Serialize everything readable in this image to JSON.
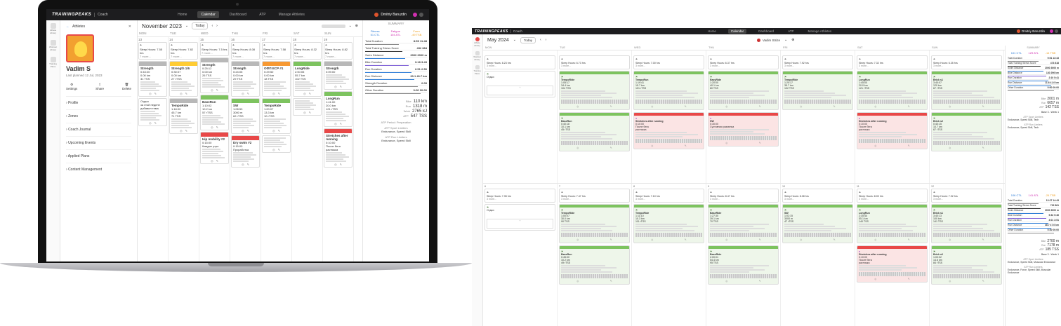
{
  "app": {
    "brand": "TRAININGPEAKS",
    "sub": "Coach",
    "nav": [
      "Home",
      "Calendar",
      "Dashboard",
      "ATP",
      "Manage Athletes"
    ],
    "active_nav": "Calendar",
    "user": "Dmitriy Baruzdin",
    "badge": "5"
  },
  "colors": {
    "nav_bg": "#1d1d1f",
    "green": "#7dc35f",
    "yellow": "#ffcc33",
    "orange": "#f79932",
    "red": "#e84848",
    "gray": "#b8b8b8",
    "accent_blue": "#2b7bd6",
    "fitness_blue": "#2b7bd6",
    "fatigue_pink": "#d12fb1",
    "form_orange": "#f0a020"
  },
  "left": {
    "sidebar": [
      {
        "label": "Athlete Library",
        "icon": "people-icon"
      },
      {
        "label": "Workout Library",
        "icon": "library-icon"
      },
      {
        "label": "Training Plans",
        "icon": "plans-icon"
      }
    ],
    "athlete_panel": {
      "header": "Athletes",
      "name": "Vadim S",
      "last_planned": "Last planned 12 Jul, 2023",
      "actions": [
        "Settings",
        "Share",
        "Delete"
      ],
      "menu": [
        "Profile",
        "Zones",
        "Coach Journal",
        "Upcoming Events",
        "Applied Plans",
        "Content Management"
      ]
    },
    "calendar": {
      "month": "November 2023",
      "today": "Today",
      "days": [
        "MON",
        "TUE",
        "WED",
        "THU",
        "FRI",
        "SAT",
        "SUN"
      ],
      "dates": [
        "13",
        "14",
        "15",
        "16",
        "17",
        "18",
        "19"
      ],
      "sleep": [
        "Sleep Hours: 7.55 hrs",
        "Sleep Hours: 7.82 hrs",
        "Sleep Hours: 7.5 hrs",
        "Sleep Hours: 8.08 hrs",
        "Sleep Hours: 7.58 hrs",
        "Sleep Hours: 8.32 hrs",
        "Sleep Hours: 8.82 hrs"
      ],
      "more": "7 more...",
      "cards": [
        [
          {
            "title": "Strength",
            "l1": "0:43:20",
            "l2": "0.00 km",
            "l3": "31 TSS",
            "color": "gy"
          },
          {
            "title": "",
            "l1": "Отдых",
            "l2": "за этой неделе",
            "l3": "добавил тема",
            "color": "none"
          }
        ],
        [
          {
            "title": "Strength 1/6",
            "l1": "0:30:07",
            "l2": "0.00 km",
            "l3": "27 rTSS",
            "color": "y"
          },
          {
            "title": "TempoRide",
            "l1": "1:18:00",
            "l2": "45.7 km",
            "l3": "71 TSS",
            "color": "gy"
          }
        ],
        [
          {
            "title": "Strength",
            "l1": "0:25:12",
            "l2": "0.00 km",
            "l3": "26 TSS",
            "color": "gy"
          },
          {
            "title": "BaseRun",
            "l1": "1:10:02",
            "l2": "10.2 km",
            "l3": "57 rTSS",
            "color": "g"
          },
          {
            "title": "Hip mobility #2",
            "l1": "0:15:00",
            "l2": "Каждое утро",
            "l3": "",
            "color": "r"
          }
        ],
        [
          {
            "title": "Strength",
            "l1": "0:24:05",
            "l2": "0.00 km",
            "l3": "29 TSS",
            "color": "gy"
          },
          {
            "title": "SW",
            "l1": "1:08:53",
            "l2": "3000 m",
            "l3": "62 rTSS",
            "color": "g"
          },
          {
            "title": "Dry swim #2",
            "l1": "0:15:00",
            "l2": "Проработка",
            "l3": "",
            "color": "r"
          }
        ],
        [
          {
            "title": "ОФП ЕСР #1",
            "l1": "0:29:50",
            "l2": "0.00 km",
            "l3": "18 TSS",
            "color": "o"
          },
          {
            "title": "TempoRide",
            "l1": "1:00:07",
            "l2": "13.3 km",
            "l3": "10 rTSS",
            "color": "g"
          },
          {
            "title": "",
            "l1": "",
            "l2": "",
            "l3": "",
            "color": "none"
          }
        ],
        [
          {
            "title": "LongRide",
            "l1": "2:00:05",
            "l2": "55.7 km",
            "l3": "102 TSS",
            "color": "g"
          },
          {
            "title": "",
            "l1": "",
            "l2": "",
            "l3": "",
            "color": "none"
          }
        ],
        [
          {
            "title": "Strength",
            "l1": "0:09:00",
            "l2": "",
            "l3": "",
            "color": "gy"
          },
          {
            "title": "LongRun",
            "l1": "1:41:00",
            "l2": "20.0 km",
            "l3": "121 rTSS",
            "color": "g"
          },
          {
            "title": "Stretches after running",
            "l1": "0:10:00",
            "l2": "После бега",
            "l3": "растяжка",
            "color": "r"
          }
        ]
      ]
    },
    "summary": {
      "title": "SUMMARY",
      "fitness_lbl": "Fitness",
      "fitness": "51 CTL",
      "fatigue_lbl": "Fatigue",
      "fatigue": "104 ATL",
      "form_lbl": "Form",
      "form": "-49 TSB",
      "rows": [
        [
          "Total Duration",
          "8:59 11:48"
        ],
        [
          "Total Training Stress Score",
          "432 684"
        ],
        [
          "Swim Distance",
          "3000 3000 m"
        ],
        [
          "Bike Duration",
          "3:18 3:43"
        ],
        [
          "Run Duration",
          "2:51 2:50"
        ],
        [
          "Run Distance",
          "30.1 40.7 km"
        ],
        [
          "Strength Duration",
          "2:09"
        ],
        [
          "Other Duration",
          "0:00 00:00"
        ]
      ],
      "extra": [
        [
          "Bike",
          "110 km"
        ],
        [
          "Run",
          "1318 m"
        ],
        [
          "Work",
          "2765 kJ"
        ],
        [
          "ATP",
          "547 TSS"
        ]
      ],
      "atp_period": "Preparation",
      "limiters": "Endurance, Speed Skill",
      "strengths": "Endurance, Speed Skill"
    }
  },
  "right": {
    "calendar": {
      "month": "May 2024",
      "today": "Today",
      "athlete": "Vadim Strize",
      "days": [
        "MON",
        "TUE",
        "WED",
        "THU",
        "FRI",
        "SAT",
        "SUN"
      ],
      "week1": {
        "dates": [
          "",
          "",
          "",
          "",
          "",
          "",
          ""
        ],
        "sleep": [
          "Sleep Hours: 8.23 hrs",
          "Sleep Hours: 6.73 hrs",
          "Sleep Hours: 7.00 hrs",
          "Sleep Hours: 6.37 hrs",
          "Sleep Hours: 7.92 hrs",
          "Sleep Hours: 7.32 hrs",
          "Sleep Hours: 6.35 hrs"
        ],
        "more": [
          "3 more...",
          "3 more...",
          "3 more...",
          "3 more...",
          "3 more...",
          "3 more...",
          "3 more..."
        ],
        "cards": [
          [
            {
              "title": "Отдых",
              "l1": "",
              "l2": "",
              "l3": "",
              "color": "none",
              "bg": "#fff"
            }
          ],
          [
            {
              "title": "TempoRide",
              "l1": "1:05:17",
              "l2": "34.4 km",
              "l3": "104 TSS",
              "color": "g",
              "bg": "#eef6ea"
            },
            {
              "title": "BaseRun",
              "l1": "0:40:18",
              "l2": "10.1 km",
              "l3": "45 rTSS",
              "color": "g",
              "bg": "#eef6ea"
            }
          ],
          [
            {
              "title": "TempoRun",
              "l1": "1:19:41",
              "l2": "15.7 km",
              "l3": "101 rTSS",
              "color": "g",
              "bg": "#eef6ea"
            },
            {
              "title": "Stretches after running",
              "l1": "0:10:00",
              "l2": "После бега",
              "l3": "растяжка",
              "color": "r",
              "bg": "#fbe4e4"
            }
          ],
          [
            {
              "title": "EasyRide",
              "l1": "1:20:00",
              "l2": "40.1 km",
              "l3": "80 TSS",
              "color": "g",
              "bg": "#eef6ea"
            },
            {
              "title": "SW",
              "l1": "0:30:00",
              "l2": "Суставная разминка",
              "l3": "",
              "color": "r",
              "bg": "#fbe4e4"
            }
          ],
          [
            {
              "title": "TempoRide",
              "l1": "1:20:17",
              "l2": "35.7 km",
              "l3": "102 TSS",
              "color": "g",
              "bg": "#eef6ea"
            }
          ],
          [
            {
              "title": "LongRun",
              "l1": "1:45:00",
              "l2": "20.0 km",
              "l3": "121 rTSS",
              "color": "g",
              "bg": "#eef6ea"
            },
            {
              "title": "Stretches after running",
              "l1": "0:10:00",
              "l2": "После бега",
              "l3": "растяжка",
              "color": "r",
              "bg": "#fbe4e4"
            }
          ],
          [
            {
              "title": "Brick s1",
              "l1": "3:40:07",
              "l2": "120 km",
              "l3": "67 rTSS",
              "color": "g",
              "bg": "#eef6ea"
            },
            {
              "title": "Brick s2",
              "l1": "0:40:15",
              "l2": "10.7 km",
              "l3": "67 rTSS",
              "color": "g",
              "bg": "#eef6ea"
            }
          ]
        ]
      },
      "week2": {
        "dates": [
          "6",
          "7",
          "8",
          "9",
          "10",
          "11",
          "12"
        ],
        "sleep": [
          "Sleep Hours: 7.35 hrs",
          "Sleep Hours: 7.47 hrs",
          "Sleep Hours: 7.10 hrs",
          "Sleep Hours: 8.47 hrs",
          "Sleep Hours: 8.08 hrs",
          "Sleep Hours: 8.00 hrs",
          "Sleep Hours: 7.92 hrs"
        ],
        "more": [
          "3 more...",
          "3 more...",
          "3 more...",
          "3 more...",
          "3 more...",
          "3 more...",
          "3 more..."
        ],
        "cards": [
          [
            {
              "title": "Отдых",
              "l1": "",
              "l2": "",
              "l3": "",
              "color": "none",
              "bg": "#fff"
            }
          ],
          [
            {
              "title": "TempoRide",
              "l1": "1:00:07",
              "l2": "30.0 km",
              "l3": "90 TSS",
              "color": "g",
              "bg": "#eef6ea"
            },
            {
              "title": "BaseRun",
              "l1": "0:45:00",
              "l2": "10.2 km",
              "l3": "49 rTSS",
              "color": "g",
              "bg": "#eef6ea"
            }
          ],
          [
            {
              "title": "TempoRide",
              "l1": "1:11:10",
              "l2": "10.3 km",
              "l3": "111 rTSS",
              "color": "g",
              "bg": "#eef6ea"
            }
          ],
          [
            {
              "title": "BaseRide",
              "l1": "1:27:30",
              "l2": "39.1 km",
              "l3": "70 TSS",
              "color": "g",
              "bg": "#eef6ea"
            },
            {
              "title": "BaseRide",
              "l1": "2:00:01",
              "l2": "54.4 km",
              "l3": "95 TSS",
              "color": "g",
              "bg": "#eef6ea"
            }
          ],
          [
            {
              "title": "SW",
              "l1": "1:02:15",
              "l2": "3000 m",
              "l3": "47 rTSS",
              "color": "g",
              "bg": "#eef6ea"
            }
          ],
          [
            {
              "title": "LongRun",
              "l1": "2:35:44",
              "l2": "55.1 km",
              "l3": "140 TSS",
              "color": "g",
              "bg": "#eef6ea"
            },
            {
              "title": "Stretches after running",
              "l1": "0:10:00",
              "l2": "После бега",
              "l3": "растяжка",
              "color": "r",
              "bg": "#fbe4e4"
            }
          ],
          [
            {
              "title": "Brick s1",
              "l1": "3:40:13",
              "l2": "100 km",
              "l3": "141 TSS",
              "color": "g",
              "bg": "#eef6ea"
            },
            {
              "title": "Brick s2",
              "l1": "1:00:02",
              "l2": "14.6 km",
              "l3": "84 rTSS",
              "color": "g",
              "bg": "#eef6ea"
            }
          ]
        ]
      },
      "summary": {
        "title": "SUMMARY",
        "w1": {
          "fitness": "101 CTL",
          "fatigue": "129 ATL",
          "form": "-14 TSB",
          "rows": [
            [
              "Total Duration",
              "9:51 13:43"
            ],
            [
              "Total Training Stress Score",
              "473 818"
            ],
            [
              "Swim Distance",
              "2000 3000 m"
            ],
            [
              "Bike Distance",
              "130 296 km"
            ],
            [
              "Run Duration",
              "2:10 5:41"
            ],
            [
              "Run Distance",
              "11.6 41.0 km"
            ],
            [
              "Other Duration",
              "0:00 00:00"
            ]
          ],
          "extra": [
            [
              "Bike",
              "2001 m"
            ],
            [
              "Run",
              "6657 m"
            ],
            [
              "ATP",
              "142 TSS"
            ]
          ],
          "period": "Base 3 - Week 1",
          "limiters": "Endurance, Speed Skill, Tech",
          "strengths": "Endurance, Speed Skill, Tech"
        },
        "w2": {
          "fitness": "106 CTL",
          "fatigue": "141 ATL",
          "form": "-24 TSB",
          "rows": [
            [
              "Total Duration",
              "13:27 14:43"
            ],
            [
              "Total Training Stress Score",
              "732 861"
            ],
            [
              "Swim Distance",
              "3000 3000 m"
            ],
            [
              "Bike Duration",
              "5:32 5:46"
            ],
            [
              "Run Duration",
              "4:01 3:51"
            ],
            [
              "Run Distance",
              "48.7 47.0 km"
            ],
            [
              "Other Duration",
              "0:30 00:00"
            ]
          ],
          "extra": [
            [
              "Bike",
              "2700 m"
            ],
            [
              "Run",
              "7178 m"
            ],
            [
              "ATP",
              "185 TSS"
            ]
          ],
          "period": "Base 3 - Week 1",
          "limiters": "Endurance, Speed Skill, Muscular Endurance",
          "strengths": "Endurance, Force, Speed Skill, Muscular Endurance"
        }
      }
    }
  }
}
